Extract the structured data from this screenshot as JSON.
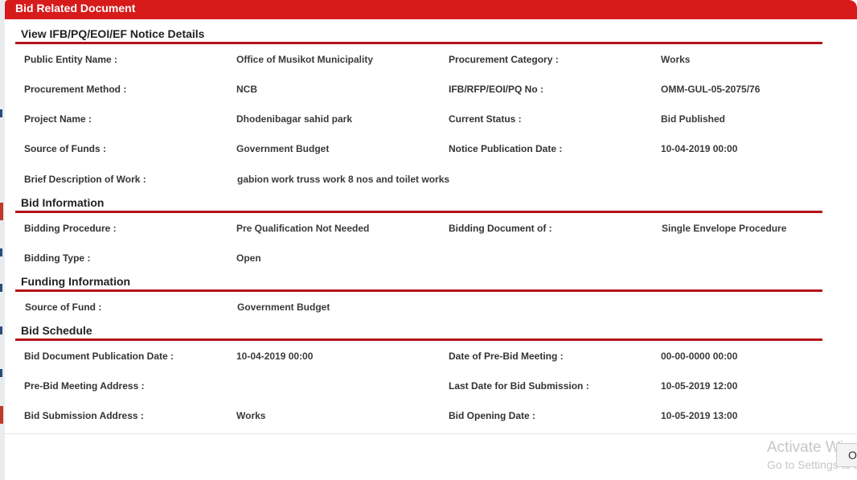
{
  "modal": {
    "title": "Bid Related Document",
    "ok_label": "O"
  },
  "sections": {
    "notice": {
      "title": "View IFB/PQ/EOI/EF Notice Details",
      "rows": [
        {
          "l1": "Public Entity Name :",
          "v1": "Office of Musikot Municipality",
          "l2": "Procurement Category :",
          "v2": "Works"
        },
        {
          "l1": "Procurement Method :",
          "v1": "NCB",
          "l2": "IFB/RFP/EOI/PQ No :",
          "v2": "OMM-GUL-05-2075/76"
        },
        {
          "l1": "Project Name :",
          "v1": "Dhodenibagar sahid park",
          "l2": "Current Status :",
          "v2": "Bid Published"
        },
        {
          "l1": "Source of Funds :",
          "v1": "Government Budget",
          "l2": "Notice Publication Date :",
          "v2": "10-04-2019 00:00"
        },
        {
          "l1": "Brief Description of Work :",
          "v1": "gabion work truss work 8 nos and toilet works",
          "l2": "",
          "v2": ""
        }
      ]
    },
    "bid_info": {
      "title": "Bid Information",
      "rows": [
        {
          "l1": "Bidding Procedure :",
          "v1": "Pre Qualification Not Needed",
          "l2": "Bidding Document of :",
          "v2": "Single Envelope Procedure"
        },
        {
          "l1": "Bidding Type :",
          "v1": "Open",
          "l2": "",
          "v2": ""
        }
      ]
    },
    "funding": {
      "title": "Funding Information",
      "rows": [
        {
          "l1": "Source of Fund :",
          "v1": "Government Budget",
          "l2": "",
          "v2": ""
        }
      ]
    },
    "schedule": {
      "title": "Bid Schedule",
      "rows": [
        {
          "l1": "Bid Document Publication Date :",
          "v1": "10-04-2019 00:00",
          "l2": "Date of Pre-Bid Meeting :",
          "v2": "00-00-0000 00:00"
        },
        {
          "l1": "Pre-Bid Meeting Address :",
          "v1": "",
          "l2": "Last Date for Bid Submission :",
          "v2": "10-05-2019 12:00"
        },
        {
          "l1": "Bid Submission Address :",
          "v1": "Works",
          "l2": "Bid Opening Date :",
          "v2": "10-05-2019 13:00"
        }
      ]
    }
  },
  "watermark": {
    "line1": "Activate Windows",
    "line2": "Go to Settings to activate Windows."
  },
  "colors": {
    "header_red": "#d71b1b",
    "rule_red": "#b5121b"
  }
}
